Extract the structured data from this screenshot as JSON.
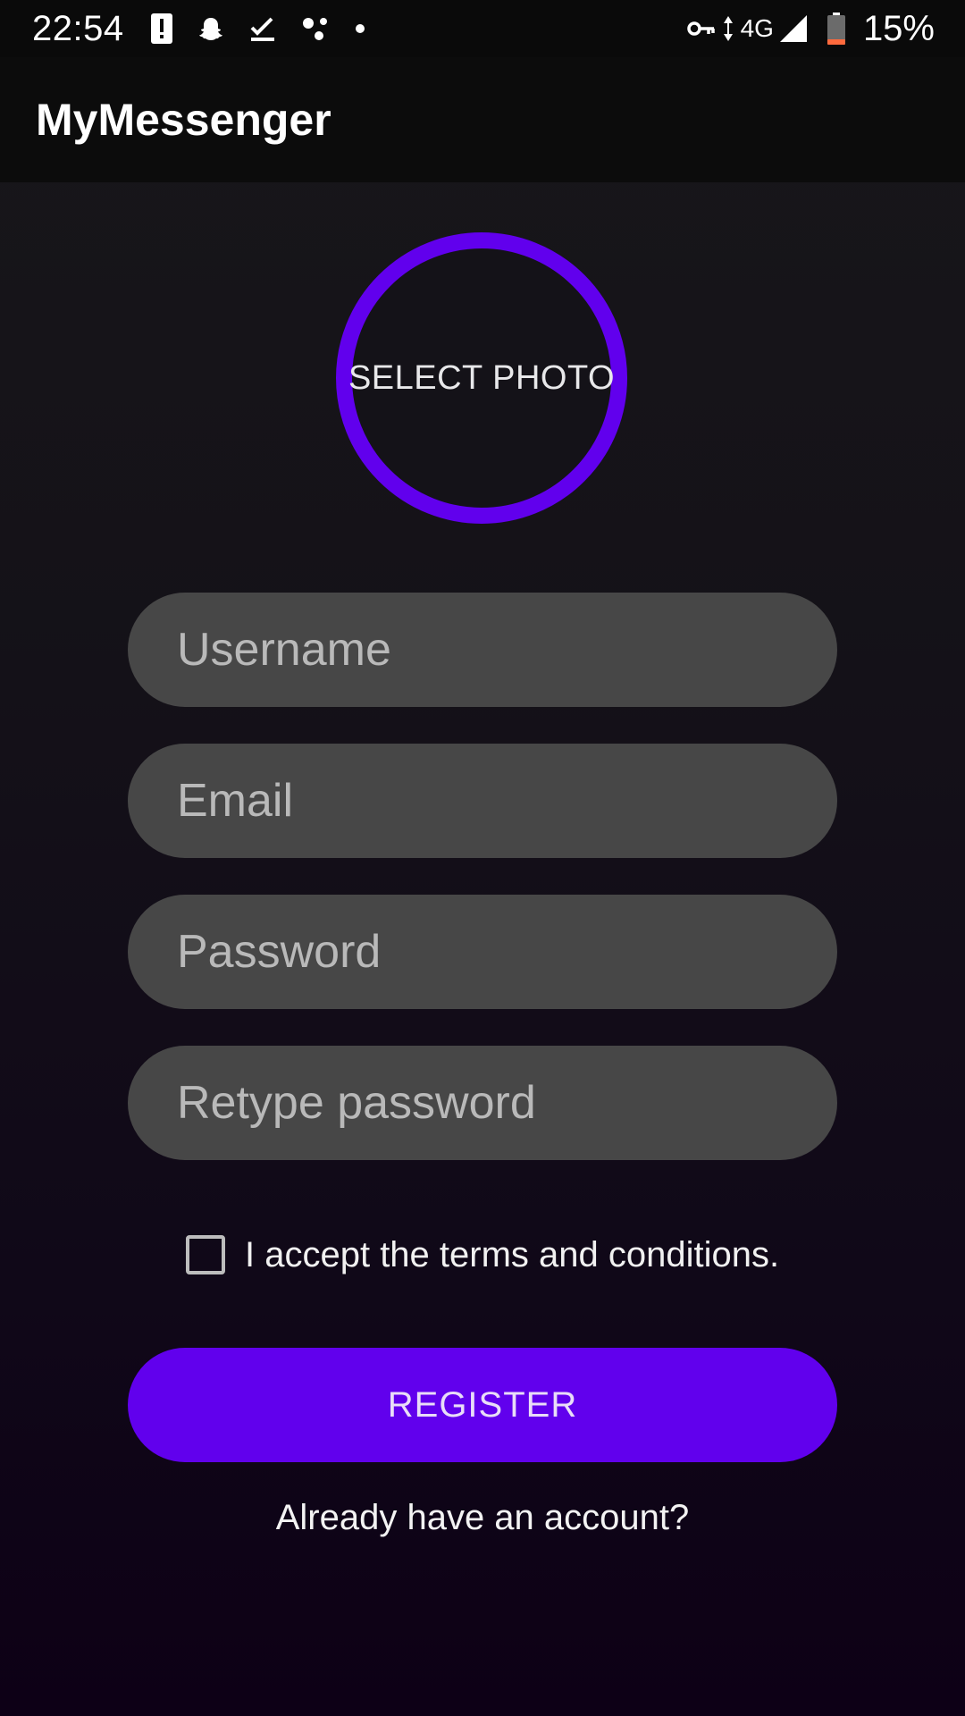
{
  "status_bar": {
    "time": "22:54",
    "left_icons": [
      "alert-icon",
      "snapchat-icon",
      "download-done-icon",
      "dots-app-icon",
      "dot-icon"
    ],
    "right_icons": [
      "vpn-key-icon",
      "data-arrows-icon",
      "signal-icon",
      "battery-icon"
    ],
    "network_type": "4G",
    "battery_percent": "15%"
  },
  "app_bar": {
    "title": "MyMessenger"
  },
  "photo": {
    "label": "SELECT PHOTO",
    "ring_color": "#6100ED"
  },
  "form": {
    "username_placeholder": "Username",
    "email_placeholder": "Email",
    "password_placeholder": "Password",
    "retype_placeholder": "Retype password",
    "username_value": "",
    "email_value": "",
    "password_value": "",
    "retype_value": ""
  },
  "terms": {
    "checked": false,
    "text": "I accept the terms and conditions."
  },
  "register": {
    "label": "REGISTER",
    "color": "#6100ED"
  },
  "login_link": {
    "text": "Already have an account?"
  }
}
